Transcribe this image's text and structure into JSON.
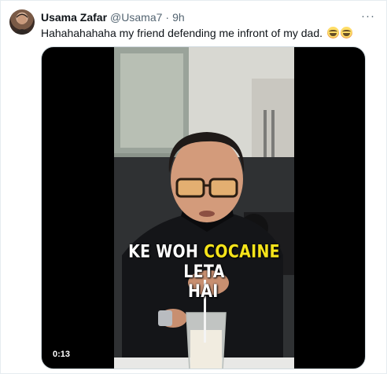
{
  "tweet": {
    "display_name": "Usama Zafar",
    "handle": "@Usama7",
    "separator": "·",
    "time": "9h",
    "text": "Hahahahahaha my friend defending me infront of my dad.",
    "emoji": [
      "face-with-tears-of-joy",
      "face-with-tears-of-joy"
    ],
    "more_label": "···"
  },
  "video": {
    "caption_part1": "KE WOH ",
    "caption_highlight": "COCAINE",
    "caption_part2": " LETA",
    "caption_line2": "HAI",
    "caption_highlight_color": "#f6e41a",
    "timecode": "0:13"
  }
}
